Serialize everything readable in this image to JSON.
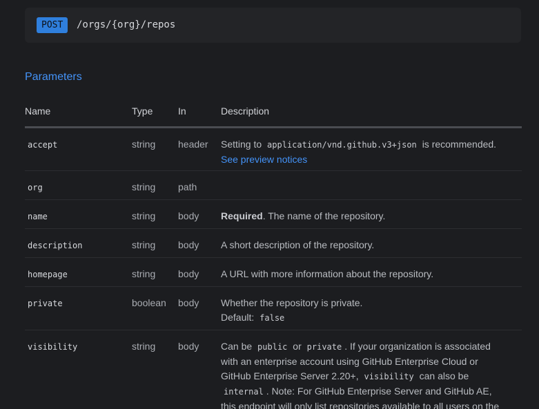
{
  "endpoint": {
    "method": "POST",
    "path": "/orgs/{org}/repos"
  },
  "section_title": "Parameters",
  "table": {
    "headers": [
      "Name",
      "Type",
      "In",
      "Description"
    ],
    "rows": [
      {
        "name": "accept",
        "type": "string",
        "in": "header",
        "desc_prefix": "Setting to",
        "desc_code": "application/vnd.github.v3+json",
        "desc_suffix": "is recommended.",
        "desc_link": "See preview notices"
      },
      {
        "name": "org",
        "type": "string",
        "in": "path"
      },
      {
        "name": "name",
        "type": "string",
        "in": "body",
        "desc_bold": "Required",
        "desc_text": ". The name of the repository."
      },
      {
        "name": "description",
        "type": "string",
        "in": "body",
        "desc_text": "A short description of the repository."
      },
      {
        "name": "homepage",
        "type": "string",
        "in": "body",
        "desc_text": "A URL with more information about the repository."
      },
      {
        "name": "private",
        "type": "boolean",
        "in": "body",
        "desc_text": "Whether the repository is private.",
        "default_label": "Default:",
        "default_value": "false"
      },
      {
        "name": "visibility",
        "type": "string",
        "in": "body",
        "desc_parts": {
          "p1": "Can be",
          "c1": "public",
          "p2": "or",
          "c2": "private",
          "p3": ". If your organization is associated",
          "p4": "with an enterprise account using GitHub Enterprise Cloud or",
          "p5": "GitHub Enterprise Server 2.20+,",
          "c3": "visibility",
          "p6": "can also be",
          "c4": "internal",
          "p7": ". Note: For GitHub Enterprise Server and GitHub AE,",
          "p8": "this endpoint will only list repositories available to all users on the"
        }
      }
    ]
  }
}
